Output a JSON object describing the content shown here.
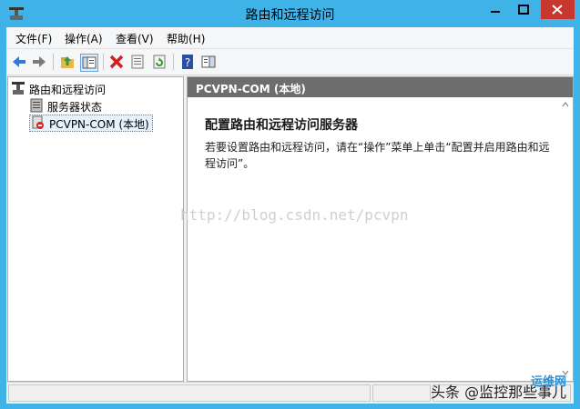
{
  "window": {
    "title": "路由和远程访问"
  },
  "menubar": {
    "items": [
      "文件(F)",
      "操作(A)",
      "查看(V)",
      "帮助(H)"
    ]
  },
  "toolbar": {
    "icons": [
      "back-arrow-icon",
      "forward-arrow-icon",
      "up-folder-icon",
      "show-hide-tree-icon",
      "delete-icon",
      "properties-icon",
      "refresh-icon",
      "help-icon",
      "action-pane-icon"
    ]
  },
  "tree": {
    "root": "路由和远程访问",
    "items": [
      "服务器状态",
      "PCVPN-COM (本地)"
    ]
  },
  "content": {
    "header": "PCVPN-COM (本地)",
    "title": "配置路由和远程访问服务器",
    "text": "若要设置路由和远程访问，请在“操作”菜单上单击“配置并启用路由和远程访问”。"
  },
  "watermark": {
    "url": "http://blog.csdn.net/pcvpn",
    "credit": "头条 @监控那些事儿",
    "logo": "运维网"
  },
  "colors": {
    "titlebar": "#3fb3e8",
    "close": "#c7372e",
    "header": "#6d6d6d"
  }
}
